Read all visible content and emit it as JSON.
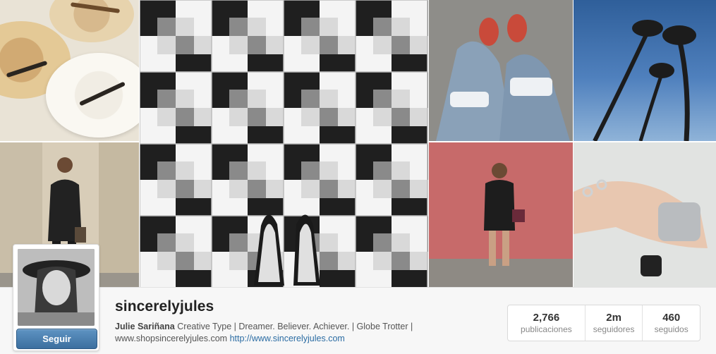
{
  "profile": {
    "username": "sincerelyjules",
    "full_name": "Julie Sariñana",
    "bio_text": "Creative Type | Dreamer. Believer. Achiever. | Globe Trotter | www.shopsincerelyjules.com",
    "website": "http://www.sincerelyjules.com",
    "follow_label": "Seguir"
  },
  "stats": [
    {
      "value": "2,766",
      "label": "publicaciones"
    },
    {
      "value": "2m",
      "label": "seguidores"
    },
    {
      "value": "460",
      "label": "seguidos"
    }
  ],
  "colors": {
    "follow_button": "#4a7fb0",
    "link": "#2b6ca3",
    "bar_background": "#f7f7f7"
  }
}
